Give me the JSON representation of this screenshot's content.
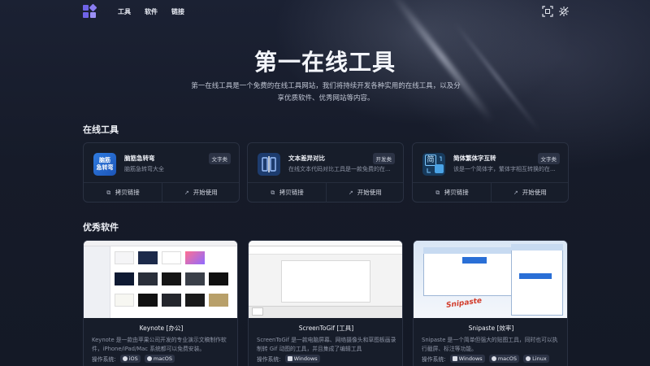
{
  "nav": {
    "logo_icon": "apps-logo-icon",
    "links": [
      "工具",
      "软件",
      "链接"
    ],
    "right_icons": [
      "scan-icon",
      "theme-toggle-icon"
    ]
  },
  "hero": {
    "title": "第一在线工具",
    "description": "第一在线工具是一个免费的在线工具网站，我们将持续开发各种实用的在线工具，以及分享优质软件、优秀网站等内容。"
  },
  "tools": {
    "section_title": "在线工具",
    "copy_label": "拷贝链接",
    "start_label": "开始使用",
    "items": [
      {
        "name": "脑筋急转弯",
        "desc": "脑筋急转弯大全",
        "tag": "文字类",
        "icon": "brain-teaser-icon",
        "icon_text": "脑筋急转弯"
      },
      {
        "name": "文本差异对比",
        "desc": "在线文本代码对比工具是一款免费的在...",
        "tag": "开发类",
        "icon": "diff-compare-icon"
      },
      {
        "name": "简体繁体字互转",
        "desc": "该是一个简体字，繁体字相互转换的在...",
        "tag": "文字类",
        "icon": "simplified-traditional-icon",
        "icon_text": "简"
      }
    ]
  },
  "software": {
    "section_title": "优秀软件",
    "os_label": "操作系统:",
    "items": [
      {
        "name": "Keynote",
        "category": "[办公]",
        "desc": "Keynote 是一款由苹果公司开发的专业演示文稿制作软件，iPhone/iPad/Mac 系统都可以免费安装。",
        "os": [
          "iOS",
          "macOS"
        ]
      },
      {
        "name": "ScreenToGif",
        "category": "[工具]",
        "desc": "ScreenToGif 是一款电脑屏幕、网络摄像头和草图板画录制转 Gif 动图的工具，并且集成了编辑工具",
        "os": [
          "Windows"
        ]
      },
      {
        "name": "Snipaste",
        "category": "[效率]",
        "desc": "Snipaste 是一个简单但强大的贴图工具，同时也可以执行截屏、标注等功能。",
        "os": [
          "Windows",
          "macOS",
          "Linux"
        ]
      }
    ],
    "snipaste_watermark": "Snipaste"
  },
  "colors": {
    "background": "#151a26",
    "card": "#181d2a",
    "tag": "#2c3345",
    "accent_blue": "#2a6fd6",
    "logo_purple": "#7b6cf0"
  }
}
